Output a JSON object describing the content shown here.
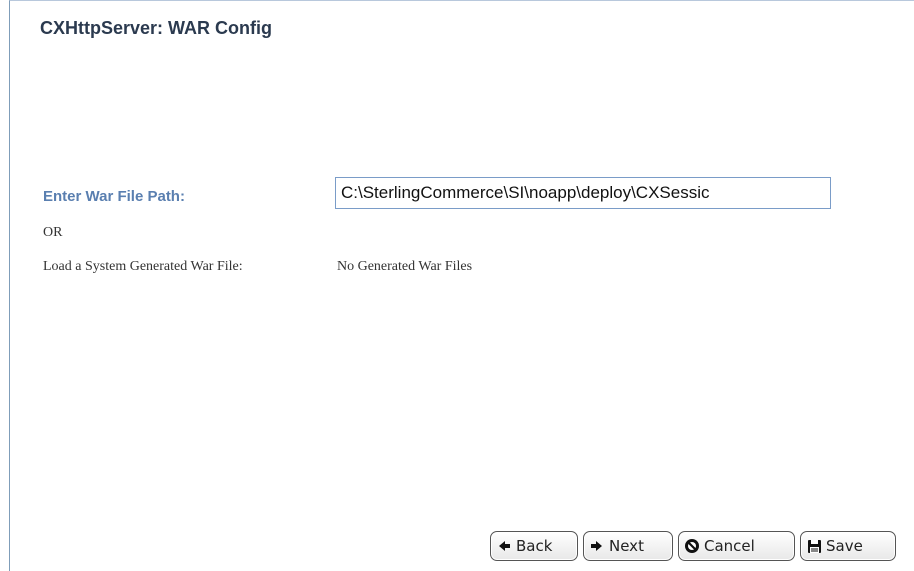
{
  "header": {
    "title": "CXHttpServer: WAR Config"
  },
  "form": {
    "war_path_label": "Enter War File Path:",
    "war_path_value": "C:\\SterlingCommerce\\SI\\noapp\\deploy\\CXSessic",
    "or_text": "OR",
    "load_label": "Load a System Generated War File:",
    "load_value": "No Generated War Files"
  },
  "buttons": {
    "back": {
      "label": "Back",
      "icon": "chevron-left-icon"
    },
    "next": {
      "label": "Next",
      "icon": "chevron-right-icon"
    },
    "cancel": {
      "label": "Cancel",
      "icon": "cancel-icon"
    },
    "save": {
      "label": "Save",
      "icon": "floppy-disk-icon"
    }
  }
}
